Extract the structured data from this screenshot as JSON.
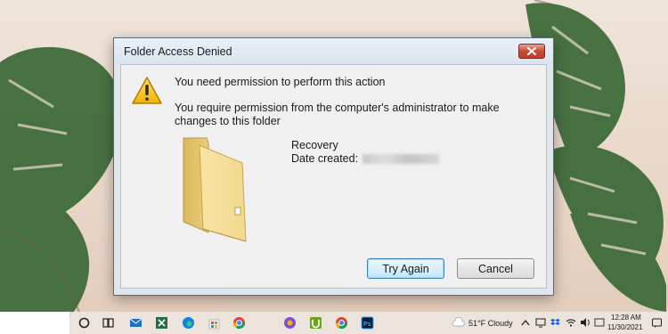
{
  "dialog": {
    "title": "Folder Access Denied",
    "close_icon": "close-icon",
    "warning_icon": "warning-icon",
    "main_message": "You need permission to perform this action",
    "detail_message": "You require permission from the computer's administrator to make changes to this folder",
    "folder": {
      "icon": "folder-icon",
      "name": "Recovery",
      "date_label": "Date created:",
      "date_value": ""
    },
    "buttons": {
      "try_again": "Try Again",
      "cancel": "Cancel"
    }
  },
  "taskbar": {
    "icons": [
      "task-view-icon",
      "mail-icon",
      "excel-icon",
      "edge-icon",
      "store-icon",
      "chrome-icon",
      "camera-app-icon",
      "utorrent-icon",
      "chrome-icon",
      "photoshop-icon"
    ],
    "weather": "51°F Cloudy",
    "clock_time": "12:28 AM",
    "clock_date": "11/30/2021"
  },
  "colors": {
    "dialog_frame": "#dfe6ee",
    "content_bg": "#f0f0f0",
    "close_button": "#c84a34",
    "default_button_border": "#3c7fb1"
  }
}
